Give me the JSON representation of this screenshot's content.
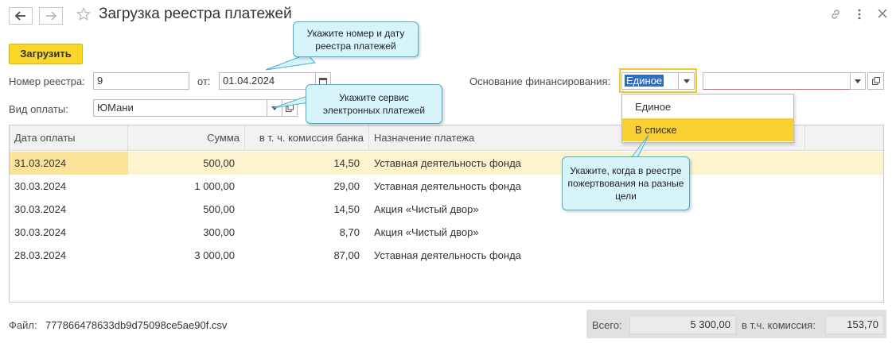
{
  "header": {
    "title": "Загрузка реестра платежей"
  },
  "toolbar": {
    "load_label": "Загрузить"
  },
  "form": {
    "registry_number_label": "Номер реестра:",
    "registry_number_value": "9",
    "date_label": "от:",
    "date_value": "01.04.2024",
    "payment_type_label": "Вид оплаты:",
    "payment_type_value": "ЮМани",
    "funding_basis_label": "Основание финансирования:",
    "funding_basis_value": "Единое",
    "funding_target_value": ""
  },
  "dropdown": {
    "options": [
      "Единое",
      "В списке"
    ],
    "highlighted": "В списке"
  },
  "table": {
    "columns": [
      "Дата оплаты",
      "Сумма",
      "в т. ч. комиссия банка",
      "Назначение платежа"
    ],
    "rows": [
      [
        "31.03.2024",
        "500,00",
        "14,50",
        "Уставная деятельность фонда"
      ],
      [
        "30.03.2024",
        "1 000,00",
        "29,00",
        "Уставная деятельность фонда"
      ],
      [
        "30.03.2024",
        "500,00",
        "14,50",
        "Акция «Чистый двор»"
      ],
      [
        "30.03.2024",
        "300,00",
        "8,70",
        "Акция «Чистый двор»"
      ],
      [
        "28.03.2024",
        "3 000,00",
        "87,00",
        "Уставная деятельность фонда"
      ]
    ]
  },
  "callouts": {
    "number_date": "Укажите номер и дату реестра платежей",
    "service": "Укажите сервис электронных платежей",
    "donations": "Укажите, когда в реестре пожертвования на разные цели"
  },
  "footer": {
    "file_label": "Файл:",
    "file_name": "777866478633db9d75098ce5ae90f.csv",
    "total_label": "Всего:",
    "total_value": "5 300,00",
    "commission_label": "в т.ч. комиссия:",
    "commission_value": "153,70"
  },
  "colors": {
    "accent_button": "#f9d72a",
    "selected_row": "#fdf3cc",
    "callout_fill": "#d8f4fb",
    "callout_border": "#43b0cf",
    "dropdown_active": "#f9cf32"
  }
}
